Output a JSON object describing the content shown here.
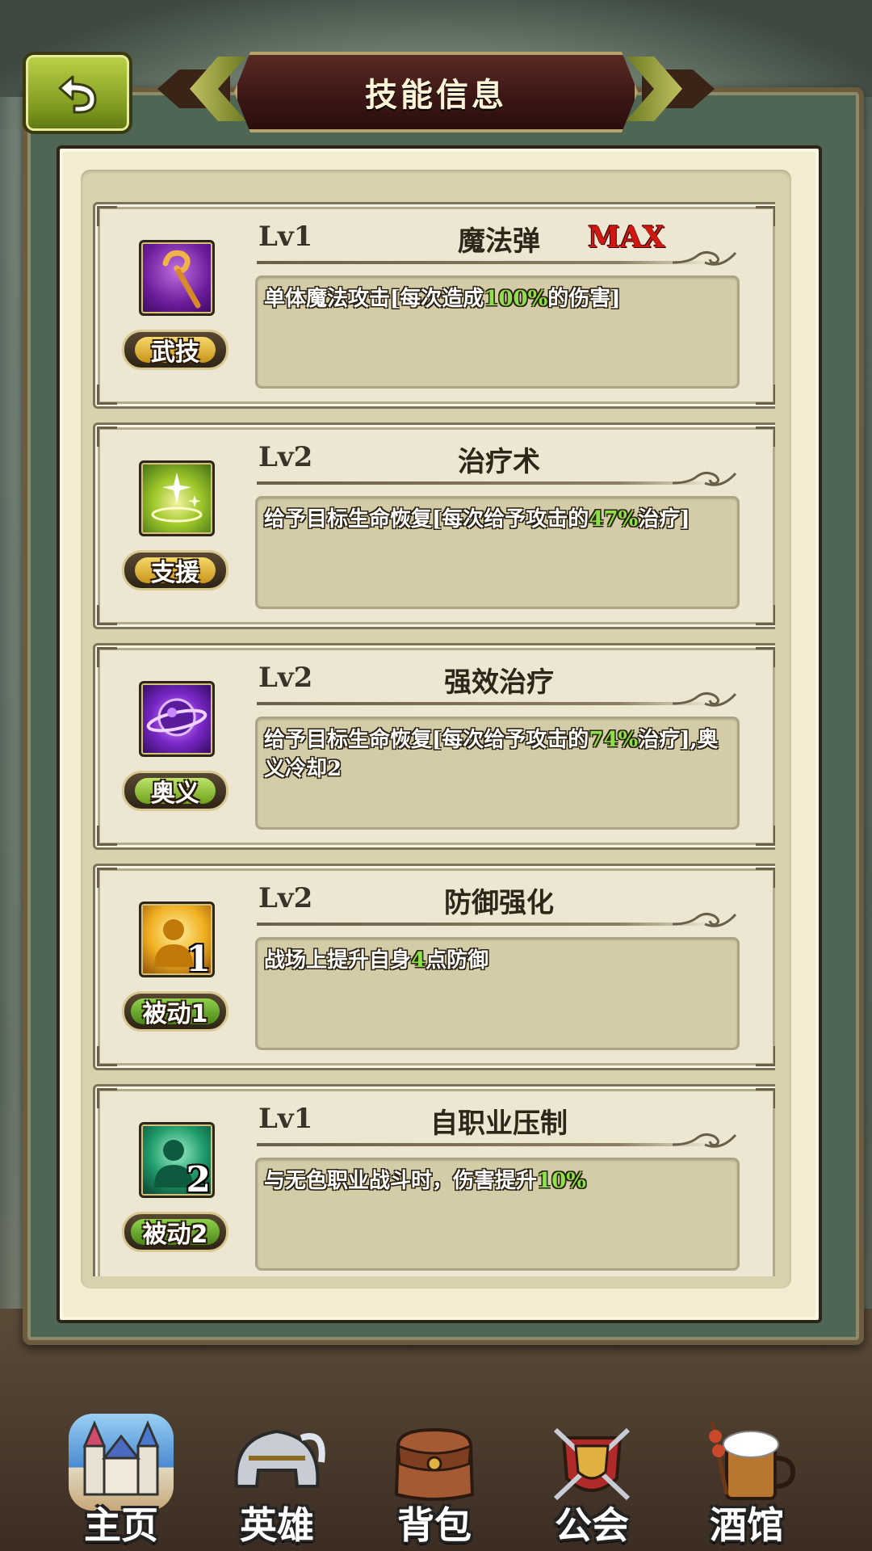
{
  "header": {
    "title": "技能信息",
    "back_icon": "back-arrow-icon"
  },
  "skills": [
    {
      "level": "Lv1",
      "name": "魔法弹",
      "max": "MAX",
      "tag": "武技",
      "icon": "magic-staff-icon",
      "desc_pre": "单体魔法攻击[每次造成",
      "desc_hl": "100%",
      "desc_post": "的伤害]"
    },
    {
      "level": "Lv2",
      "name": "治疗术",
      "tag": "支援",
      "icon": "heal-sparkle-icon",
      "desc_pre": "给予目标生命恢复[每次给予攻击的",
      "desc_hl": "47%",
      "desc_post": "治疗]"
    },
    {
      "level": "Lv2",
      "name": "强效治疗",
      "tag": "奥义",
      "icon": "arcane-orb-icon",
      "desc_pre": "给予目标生命恢复[每次给予攻击的",
      "desc_hl": "74%",
      "desc_post": "治疗],奥义冷却2"
    },
    {
      "level": "Lv2",
      "name": "防御强化",
      "tag": "被动1",
      "icon": "passive-person-gold-icon",
      "icon_number": "1",
      "desc_pre": "战场上提升自身",
      "desc_hl": "4",
      "desc_post": "点防御"
    },
    {
      "level": "Lv1",
      "name": "自职业压制",
      "tag": "被动2",
      "icon": "passive-person-teal-icon",
      "icon_number": "2",
      "desc_pre": "与无色职业战斗时，伤害提升",
      "desc_hl": "10%",
      "desc_post": ""
    }
  ],
  "nav": [
    {
      "label": "主页",
      "icon": "castle-icon"
    },
    {
      "label": "英雄",
      "icon": "helmet-icon"
    },
    {
      "label": "背包",
      "icon": "backpack-icon"
    },
    {
      "label": "公会",
      "icon": "guild-shield-icon"
    },
    {
      "label": "酒馆",
      "icon": "tavern-mug-icon"
    }
  ],
  "colors": {
    "highlight": "#8ee04a",
    "max_red": "#d01810",
    "title_bg": "#3a1614",
    "back_btn_green": "#9ab42a"
  }
}
